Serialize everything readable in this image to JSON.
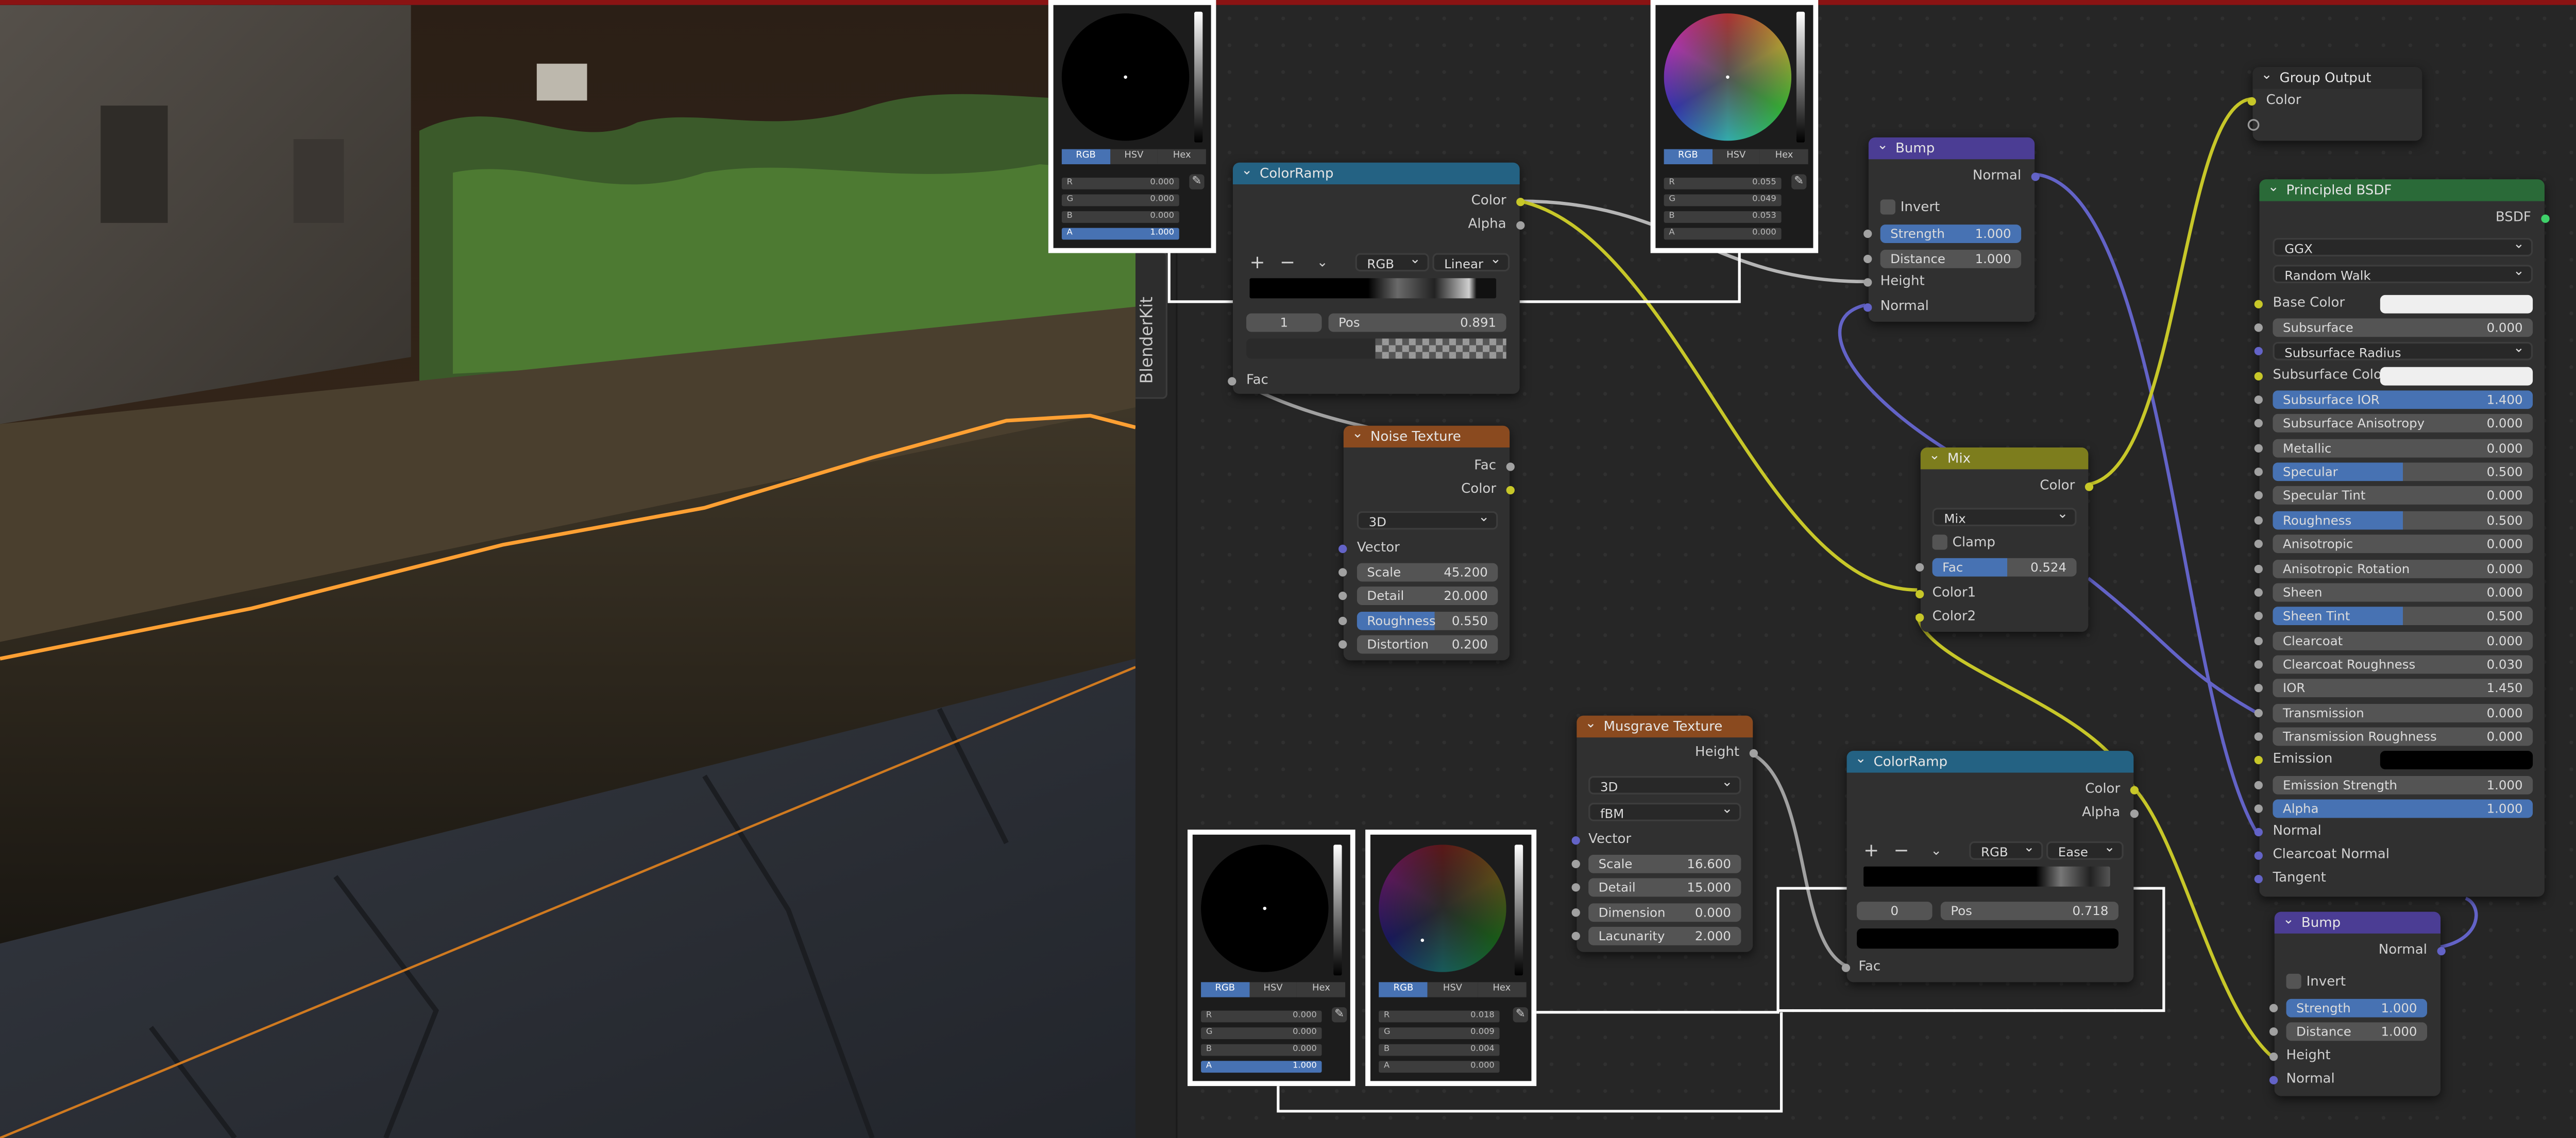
{
  "sidebar_tab": "BlenderKit",
  "pickers": {
    "top_left": {
      "tabs": [
        "RGB",
        "HSV",
        "Hex"
      ],
      "fields": [
        [
          "R",
          "0.000"
        ],
        [
          "G",
          "0.000"
        ],
        [
          "B",
          "0.000"
        ],
        [
          "A",
          "1.000"
        ]
      ]
    },
    "top_mid": {
      "tabs": [
        "RGB",
        "HSV",
        "Hex"
      ],
      "fields": [
        [
          "R",
          "0.055"
        ],
        [
          "G",
          "0.049"
        ],
        [
          "B",
          "0.053"
        ],
        [
          "A",
          "0.000"
        ]
      ]
    },
    "bottom_left": {
      "tabs": [
        "RGB",
        "HSV",
        "Hex"
      ],
      "fields": [
        [
          "R",
          "0.000"
        ],
        [
          "G",
          "0.000"
        ],
        [
          "B",
          "0.000"
        ],
        [
          "A",
          "1.000"
        ]
      ]
    },
    "bottom_mid": {
      "tabs": [
        "RGB",
        "HSV",
        "Hex"
      ],
      "fields": [
        [
          "R",
          "0.018"
        ],
        [
          "G",
          "0.009"
        ],
        [
          "B",
          "0.004"
        ],
        [
          "A",
          "0.000"
        ]
      ]
    }
  },
  "colorramp1": {
    "title": "ColorRamp",
    "out_color": "Color",
    "out_alpha": "Alpha",
    "plus": "+",
    "minus": "−",
    "mode": "RGB",
    "interp": "Linear",
    "index": "1",
    "pos_label": "Pos",
    "pos": "0.891",
    "in_fac": "Fac"
  },
  "noise": {
    "title": "Noise Texture",
    "out_fac": "Fac",
    "out_color": "Color",
    "dim": "3D",
    "vector": "Vector",
    "fields": [
      [
        "Scale",
        "45.200"
      ],
      [
        "Detail",
        "20.000"
      ],
      [
        "Roughness",
        "0.550"
      ],
      [
        "Distortion",
        "0.200"
      ]
    ]
  },
  "bump1": {
    "title": "Bump",
    "out_normal": "Normal",
    "invert": "Invert",
    "strength_label": "Strength",
    "strength": "1.000",
    "distance_label": "Distance",
    "distance": "1.000",
    "in_height": "Height",
    "in_normal": "Normal"
  },
  "mix": {
    "title": "Mix",
    "out_color": "Color",
    "mode": "Mix",
    "clamp": "Clamp",
    "fac_label": "Fac",
    "fac": "0.524",
    "in1": "Color1",
    "in2": "Color2"
  },
  "group_output": {
    "title": "Group Output",
    "in_color": "Color"
  },
  "principled": {
    "title": "Principled BSDF",
    "out": "BSDF",
    "dist": "GGX",
    "sss": "Random Walk",
    "base_color": "Base Color",
    "rows": [
      [
        "Subsurface",
        "0.000"
      ],
      [
        "Subsurface Radius",
        ""
      ],
      [
        "Subsurface Colo",
        ""
      ],
      [
        "Subsurface IOR",
        "1.400"
      ],
      [
        "Subsurface Anisotropy",
        "0.000"
      ],
      [
        "Metallic",
        "0.000"
      ],
      [
        "Specular",
        "0.500"
      ],
      [
        "Specular Tint",
        "0.000"
      ],
      [
        "Roughness",
        "0.500"
      ],
      [
        "Anisotropic",
        "0.000"
      ],
      [
        "Anisotropic Rotation",
        "0.000"
      ],
      [
        "Sheen",
        "0.000"
      ],
      [
        "Sheen Tint",
        "0.500"
      ],
      [
        "Clearcoat",
        "0.000"
      ],
      [
        "Clearcoat Roughness",
        "0.030"
      ],
      [
        "IOR",
        "1.450"
      ],
      [
        "Transmission",
        "0.000"
      ],
      [
        "Transmission Roughness",
        "0.000"
      ],
      [
        "Emission",
        ""
      ],
      [
        "Emission Strength",
        "1.000"
      ],
      [
        "Alpha",
        "1.000"
      ]
    ],
    "normal": "Normal",
    "clearcoat_normal": "Clearcoat Normal",
    "tangent": "Tangent"
  },
  "musgrave": {
    "title": "Musgrave Texture",
    "out_height": "Height",
    "dim": "3D",
    "type": "fBM",
    "vector": "Vector",
    "fields": [
      [
        "Scale",
        "16.600"
      ],
      [
        "Detail",
        "15.000"
      ],
      [
        "Dimension",
        "0.000"
      ],
      [
        "Lacunarity",
        "2.000"
      ]
    ]
  },
  "colorramp2": {
    "title": "ColorRamp",
    "out_color": "Color",
    "out_alpha": "Alpha",
    "plus": "+",
    "minus": "−",
    "mode": "RGB",
    "interp": "Ease",
    "index": "0",
    "pos_label": "Pos",
    "pos": "0.718",
    "in_fac": "Fac"
  },
  "bump2": {
    "title": "Bump",
    "out_normal": "Normal",
    "invert": "Invert",
    "strength_label": "Strength",
    "strength": "1.000",
    "distance_label": "Distance",
    "distance": "1.000",
    "in_height": "Height",
    "in_normal": "Normal"
  },
  "colors": {
    "accent": "#4772b3",
    "wire_yellow": "#c7c729",
    "wire_gray": "#a1a1a1",
    "wire_purple": "#6363c7",
    "selection": "#ffa033"
  }
}
